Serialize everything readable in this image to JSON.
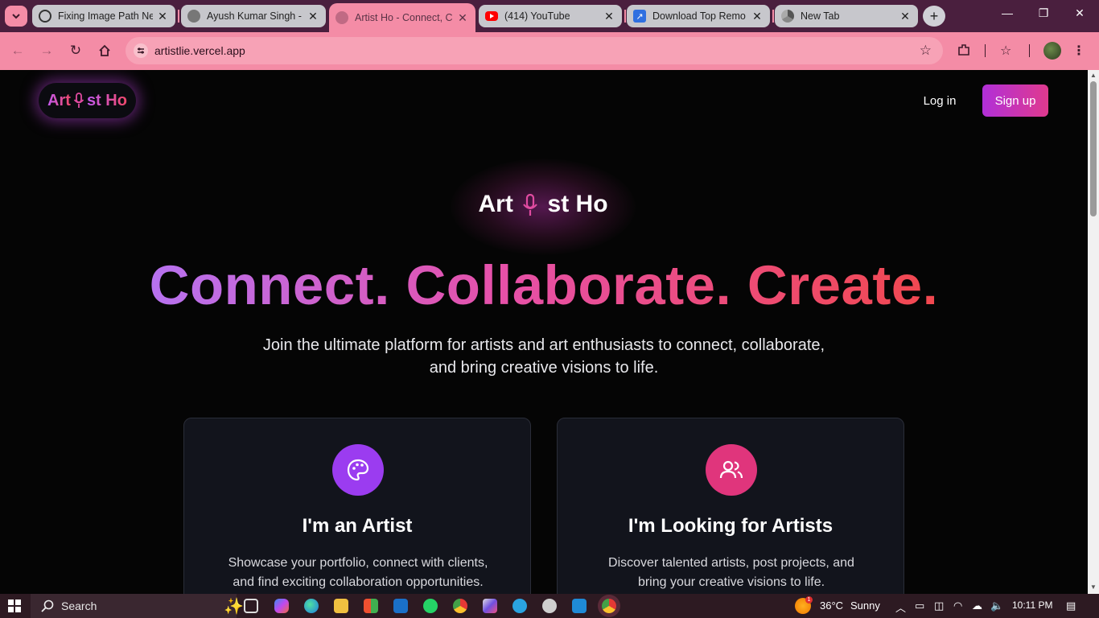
{
  "browser": {
    "tabs": [
      {
        "title": "Fixing Image Path Ne",
        "favicon": "openai-icon"
      },
      {
        "title": "Ayush Kumar Singh -",
        "favicon": "globe-icon"
      },
      {
        "title": "Artist Ho - Connect, C",
        "favicon": "globe-icon",
        "active": true
      },
      {
        "title": "(414) YouTube",
        "favicon": "youtube-icon"
      },
      {
        "title": "Download Top Remo",
        "favicon": "arrow-icon"
      },
      {
        "title": "New Tab",
        "favicon": "chrome-icon"
      }
    ],
    "url": "artistlie.vercel.app"
  },
  "site": {
    "logo_left": "Art",
    "logo_right": "st Ho",
    "nav": {
      "login": "Log in",
      "signup": "Sign up"
    },
    "hero": {
      "logo_left": "Art",
      "logo_right": "st Ho",
      "headline": "Connect. Collaborate. Create.",
      "subtitle_line1": "Join the ultimate platform for artists and art enthusiasts to connect, collaborate,",
      "subtitle_line2": "and bring creative visions to life."
    },
    "cards": [
      {
        "title": "I'm an Artist",
        "line1": "Showcase your portfolio, connect with clients,",
        "line2": "and find exciting collaboration opportunities.",
        "icon": "palette-icon",
        "color": "#9b3cf0"
      },
      {
        "title": "I'm Looking for Artists",
        "line1": "Discover talented artists, post projects, and",
        "line2": "bring your creative visions to life.",
        "icon": "users-icon",
        "color": "#e0357c"
      }
    ]
  },
  "taskbar": {
    "search": "Search",
    "weather_temp": "36°C",
    "weather_cond": "Sunny",
    "notif_count": "1",
    "time": "10:11 PM"
  },
  "colors": {
    "tab_accent": "#f48ca6",
    "tabstrip_bg": "#4a1f3e",
    "brand_purple": "#b12fd8",
    "brand_pink": "#e03a8e"
  }
}
